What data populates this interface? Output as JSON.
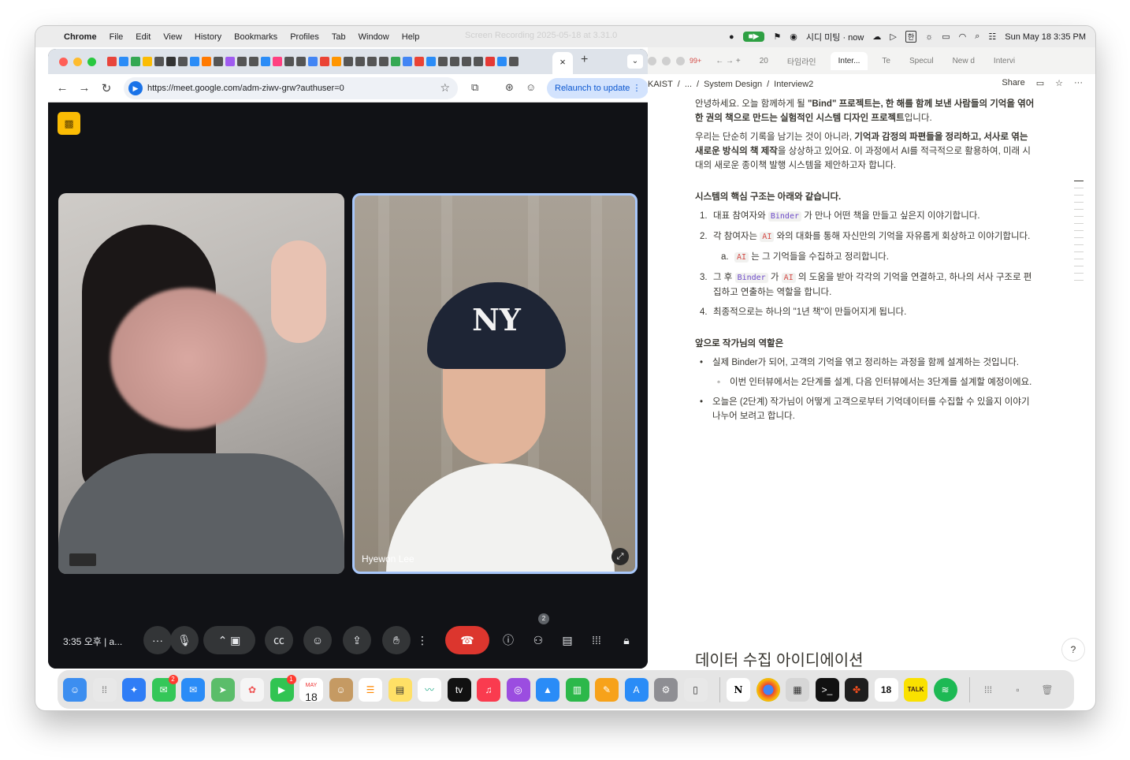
{
  "menubar": {
    "app_name": "Chrome",
    "menus": [
      "File",
      "Edit",
      "View",
      "History",
      "Bookmarks",
      "Profiles",
      "Tab",
      "Window",
      "Help"
    ],
    "recording_title": "Screen Recording 2025-05-18 at 3.31.0",
    "calendar_event": "시디 미팅 · now",
    "datetime": "Sun May 18  3:35 PM"
  },
  "chrome": {
    "url": "https://meet.google.com/adm-ziwv-grw?authuser=0",
    "relaunch_label": "Relaunch to update",
    "close_tab_glyph": "×",
    "new_tab_glyph": "+"
  },
  "meet": {
    "time_label": "3:35 오후  |  a...",
    "participant_name": "Hyewon Lee",
    "people_count": "2",
    "controls": [
      "more-options",
      "microphone",
      "camera-options",
      "camera",
      "captions",
      "emoji",
      "present",
      "raise-hand",
      "more-actions",
      "end-call",
      "info",
      "people",
      "chat",
      "activities",
      "host-controls"
    ]
  },
  "doc": {
    "tabs": [
      "99+",
      "20",
      "타임라인",
      "Inter...",
      "Te",
      "Specul",
      "New d",
      "Intervi"
    ],
    "breadcrumb": [
      "KAIST",
      "/",
      "...",
      "/",
      "System Design",
      "/",
      "Interview2"
    ],
    "share_label": "Share",
    "intro_1a": "안녕하세요. 오늘 함께하게 될 ",
    "intro_1b": "\"Bind\" 프로젝트는, 한 해를 함께 보낸 사람들의 기억을 엮어 한 권의 책으로 만드는 실험적인 시스템 디자인 프로젝트",
    "intro_1c": "입니다.",
    "intro_2a": "우리는 단순히 기록을 남기는 것이 아니라, ",
    "intro_2b": "기억과 감정의 파편들을 정리하고, 서사로 엮는 새로운 방식의 책 제작",
    "intro_2c": "을 상상하고 있어요. 이 과정에서 AI를 적극적으로 활용하여, 미래 시대의 새로운 종이책 발행 시스템을 제안하고자 합니다.",
    "section_title": "시스템의 핵심 구조는 아래와 같습니다.",
    "items": [
      {
        "num": "1.",
        "pre": "대표 참여자와 ",
        "code": "Binder",
        "post": " 가 만나 어떤 책을 만들고 싶은지 이야기합니다."
      },
      {
        "num": "2.",
        "pre": "각 참여자는 ",
        "code": "AI",
        "post": " 와의 대화를 통해 자신만의 기억을 자유롭게 회상하고 이야기합니다."
      },
      {
        "num": "3.",
        "pre": "그 후 ",
        "code": "Binder",
        "mid": " 가 ",
        "code2": "AI",
        "post": " 의 도움을 받아 각각의 기억을 연결하고, 하나의 서사 구조로 편집하고 연출하는 역할을 합니다."
      },
      {
        "num": "4.",
        "pre": "최종적으로는 하나의 \"1년 책\"이 만들어지게 됩니다.",
        "code": "",
        "post": ""
      }
    ],
    "sub_item": {
      "num": "a.",
      "code": "AI",
      "post": " 는 그 기억들을 수집하고 정리합니다."
    },
    "role_title": "앞으로 작가님의 역할은",
    "bullets": [
      "실제 Binder가 되어, 고객의 기억을 엮고 정리하는 과정을 함께 설계하는 것입니다.",
      "오늘은 (2단계) 작가님이 어떻게 고객으로부터 기억데이터를 수집할 수 있을지 이야기 나누어 보려고 합니다."
    ],
    "sub_bullet": "이번 인터뷰에서는 2단계를 설계, 다음 인터뷰에서는 3단계를 설계할 예정이에요.",
    "bottom_heading": "데이터 수집 아이디에이션"
  },
  "dock": {
    "calendar_month": "MAY",
    "calendar_day": "18",
    "messages_badge": "2",
    "facetime_badge": "1",
    "tv_label": "tv",
    "notion_letter": "N",
    "kakao_label": "TALK"
  },
  "colors": {
    "meet_bg": "#111216",
    "end_call": "#dc362e",
    "active_tile_border": "#a8c7fa",
    "relaunch_bg": "#d3e3fd"
  }
}
